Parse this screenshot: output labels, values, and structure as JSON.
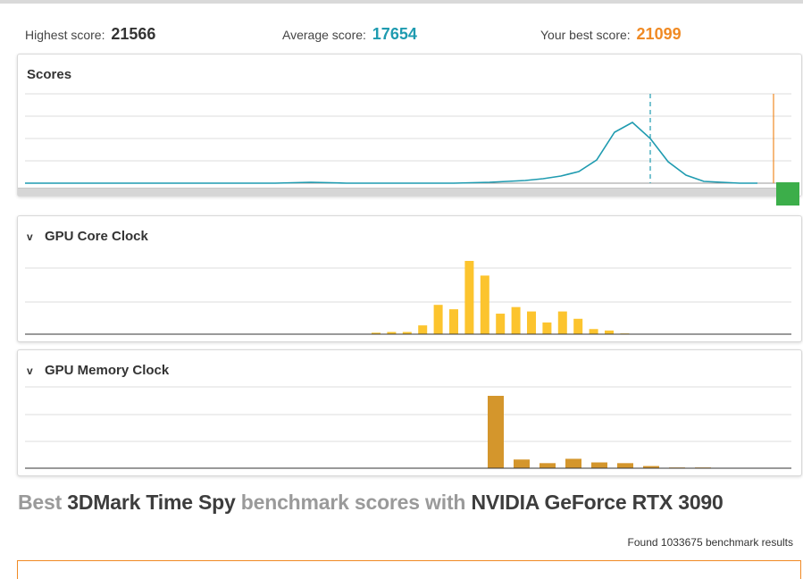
{
  "stats": {
    "highest_label": "Highest score:",
    "highest_value": "21566",
    "average_label": "Average score:",
    "average_value": "17654",
    "best_label": "Your best score:",
    "best_value": "21099"
  },
  "panels": {
    "scores_title": "Scores",
    "core_title": "GPU Core Clock",
    "memory_title": "GPU Memory Clock",
    "chevron_glyph": "v"
  },
  "headline": {
    "part1": "Best",
    "part2": "3DMark Time Spy",
    "part3": "benchmark scores with",
    "part4": "NVIDIA GeForce RTX 3090"
  },
  "footer": {
    "found_text": "Found 1033675 benchmark results"
  },
  "colors": {
    "average": "#1f9bb0",
    "best": "#f08a24",
    "core_bars": "#fcc42e",
    "memory_bars": "#d4962c",
    "handle": "#3cae4a"
  },
  "chart_data": [
    {
      "type": "line",
      "name": "scores-distribution",
      "x": [
        0,
        40,
        80,
        120,
        160,
        200,
        240,
        280,
        320,
        360,
        400,
        440,
        480,
        520,
        540,
        560,
        580,
        600,
        620,
        640,
        660,
        680,
        700,
        720,
        740,
        760,
        780,
        800,
        820
      ],
      "y": [
        0,
        0,
        0,
        0,
        0,
        0,
        0,
        0,
        0.01,
        0,
        0,
        0,
        0,
        0.01,
        0.02,
        0.03,
        0.05,
        0.08,
        0.13,
        0.26,
        0.57,
        0.68,
        0.5,
        0.24,
        0.09,
        0.02,
        0.01,
        0,
        0
      ],
      "ylim": [
        0,
        1
      ],
      "average_marker_x": 700,
      "best_marker_x": 838,
      "grid": true
    },
    {
      "type": "bar",
      "name": "gpu-core-clock",
      "values": [
        0.02,
        0.03,
        0.03,
        0.12,
        0.4,
        0.34,
        1.0,
        0.8,
        0.28,
        0.37,
        0.31,
        0.16,
        0.31,
        0.21,
        0.07,
        0.05,
        0.01
      ],
      "ylim": [
        0,
        1
      ],
      "grid": true
    },
    {
      "type": "bar",
      "name": "gpu-memory-clock",
      "values": [
        1.0,
        0.12,
        0.07,
        0.13,
        0.08,
        0.07,
        0.03,
        0.01,
        0.01
      ],
      "ylim": [
        0,
        1
      ],
      "grid": true
    }
  ]
}
